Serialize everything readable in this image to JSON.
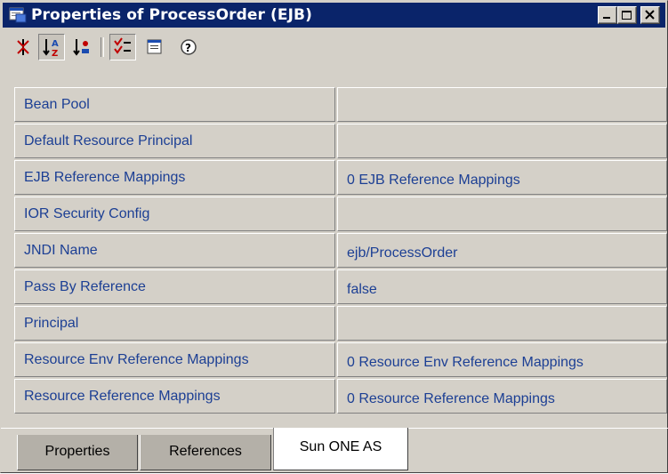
{
  "window": {
    "title": "Properties of ProcessOrder (EJB)",
    "title_bar_color": "#0a246a",
    "controls": [
      "minimize-icon",
      "maximize-icon",
      "close-icon"
    ]
  },
  "toolbar": {
    "buttons": [
      {
        "name": "sort-by-category",
        "icon": "category-sort-icon",
        "pressed": false
      },
      {
        "name": "sort-by-name",
        "icon": "alpha-sort-icon",
        "pressed": true
      },
      {
        "name": "sort-by-type",
        "icon": "type-sort-icon",
        "pressed": false
      },
      {
        "name": "show-editable",
        "icon": "editable-properties-icon",
        "pressed": true
      },
      {
        "name": "customizer",
        "icon": "customizer-icon",
        "pressed": false
      },
      {
        "name": "help",
        "icon": "help-icon",
        "pressed": false
      }
    ]
  },
  "properties": [
    {
      "name": "Bean Pool",
      "value": ""
    },
    {
      "name": "Default Resource Principal",
      "value": ""
    },
    {
      "name": "EJB Reference Mappings",
      "value": "0 EJB Reference Mappings"
    },
    {
      "name": "IOR Security Config",
      "value": ""
    },
    {
      "name": "JNDI Name",
      "value": "ejb/ProcessOrder"
    },
    {
      "name": "Pass By Reference",
      "value": "false"
    },
    {
      "name": "Principal",
      "value": ""
    },
    {
      "name": "Resource Env Reference Mappings",
      "value": "0 Resource Env Reference Mappings"
    },
    {
      "name": "Resource Reference Mappings",
      "value": "0 Resource Reference Mappings"
    }
  ],
  "tabs": [
    {
      "label": "Properties",
      "active": false
    },
    {
      "label": "References",
      "active": false
    },
    {
      "label": "Sun ONE AS",
      "active": true
    }
  ],
  "colors": {
    "property_text": "#1c3f94",
    "panel_bg": "#d4d0c8"
  }
}
